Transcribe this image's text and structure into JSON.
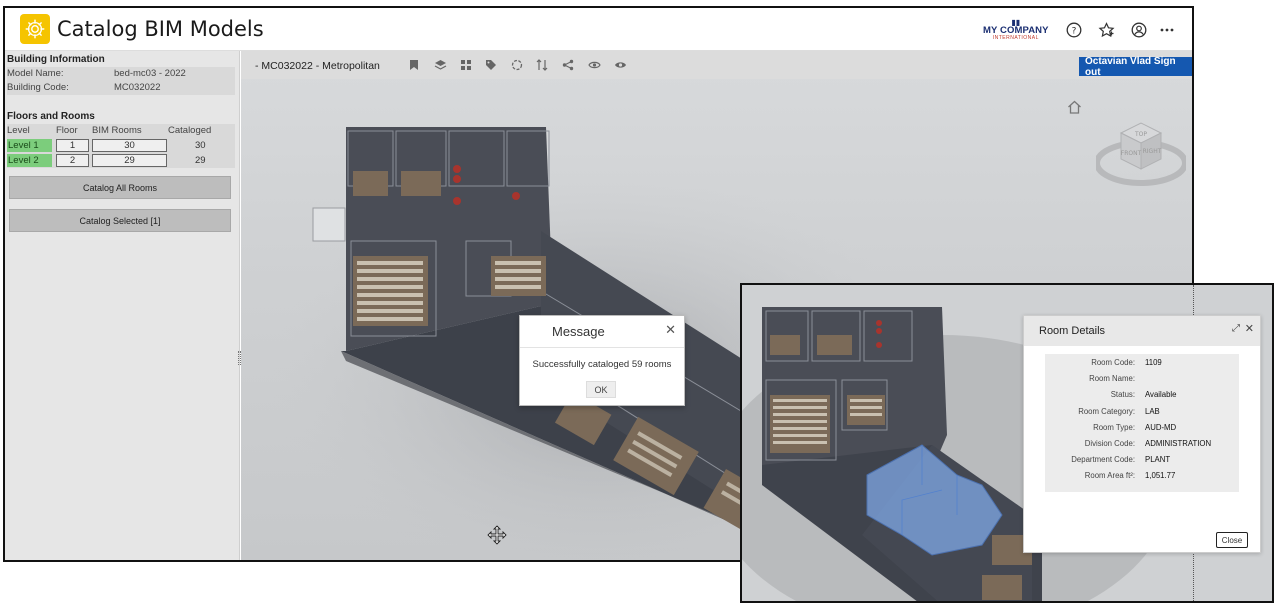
{
  "header": {
    "title": "Catalog BIM Models",
    "company": {
      "name": "MY COMPANY",
      "sub": "INTERNATIONAL"
    },
    "icons": [
      "help-icon",
      "favorites-icon",
      "account-icon",
      "more-icon"
    ]
  },
  "building_info": {
    "section_title": "Building Information",
    "model_name_label": "Model Name:",
    "model_name": "bed-mc03 - 2022",
    "building_code_label": "Building Code:",
    "building_code": "MC032022"
  },
  "floors": {
    "section_title": "Floors and Rooms",
    "columns": [
      "Level",
      "Floor",
      "BIM Rooms",
      "Cataloged"
    ],
    "rows": [
      {
        "level": "Level 1",
        "floor": "1",
        "bim_rooms": "30",
        "cataloged": "30"
      },
      {
        "level": "Level 2",
        "floor": "2",
        "bim_rooms": "29",
        "cataloged": "29"
      }
    ],
    "catalog_all_label": "Catalog All Rooms",
    "catalog_selected_label": "Catalog Selected [1]"
  },
  "viewer": {
    "model_title": "- MC032022 - Metropolitan",
    "signout_label": "Octavian Vlad Sign out",
    "toolbar_icons": [
      "bookmark-icon",
      "layers-icon",
      "grid-icon",
      "tag-icon",
      "rotate-icon",
      "sort-icon",
      "share-icon",
      "eye-icon",
      "settings-icon"
    ],
    "viewcube_labels": {
      "top": "TOP",
      "front": "FRONT",
      "right": "RIGHT"
    }
  },
  "message_dialog": {
    "title": "Message",
    "text": "Successfully cataloged 59 rooms",
    "ok_label": "OK"
  },
  "room_details": {
    "title": "Room Details",
    "fields": [
      {
        "label": "Room Code:",
        "value": "1109"
      },
      {
        "label": "Room Name:",
        "value": ""
      },
      {
        "label": "Status:",
        "value": "Available"
      },
      {
        "label": "Room Category:",
        "value": "LAB"
      },
      {
        "label": "Room Type:",
        "value": "AUD-MD"
      },
      {
        "label": "Division Code:",
        "value": "ADMINISTRATION"
      },
      {
        "label": "Department Code:",
        "value": "PLANT"
      },
      {
        "label": "Room Area ft²:",
        "value": "1,051.77"
      }
    ],
    "close_label": "Close"
  },
  "colors": {
    "brand_yellow": "#f5c400",
    "signout_blue": "#1558b0",
    "level_green": "#7ccd7c",
    "highlight_blue": "#7fa8e6"
  }
}
